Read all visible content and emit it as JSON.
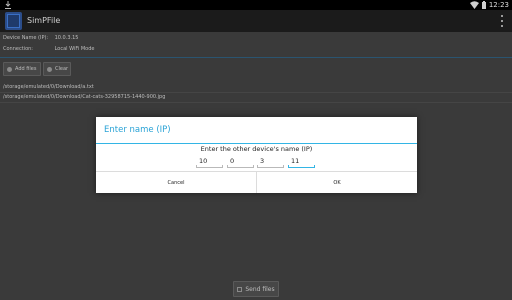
{
  "status_bar": {
    "time": "12:23",
    "icons": [
      "download-icon",
      "wifi-icon",
      "battery-icon"
    ]
  },
  "app": {
    "title": "SimPFile",
    "icon": "app-icon"
  },
  "info": {
    "device_name_label": "Device Name (IP):",
    "device_name_value": "10.0.3.15",
    "connection_label": "Connection:",
    "connection_value": "Local WiFi Mode"
  },
  "actions": {
    "add_files": "Add files",
    "clear": "Clear",
    "send_files": "Send files"
  },
  "files": [
    "/storage/emulated/0/Download/a.txt",
    "/storage/emulated/0/Download/Cat-cats-32958715-1440-900.jpg"
  ],
  "dialog": {
    "title": "Enter name (IP)",
    "prompt": "Enter the other device's name (IP)",
    "ip_octets": [
      "10",
      "0",
      "3",
      "11"
    ],
    "cancel": "Cancel",
    "ok": "OK"
  },
  "colors": {
    "accent": "#33b5e5",
    "title_blue": "#2aa3d6",
    "dim_background": "#3a3a3a"
  }
}
